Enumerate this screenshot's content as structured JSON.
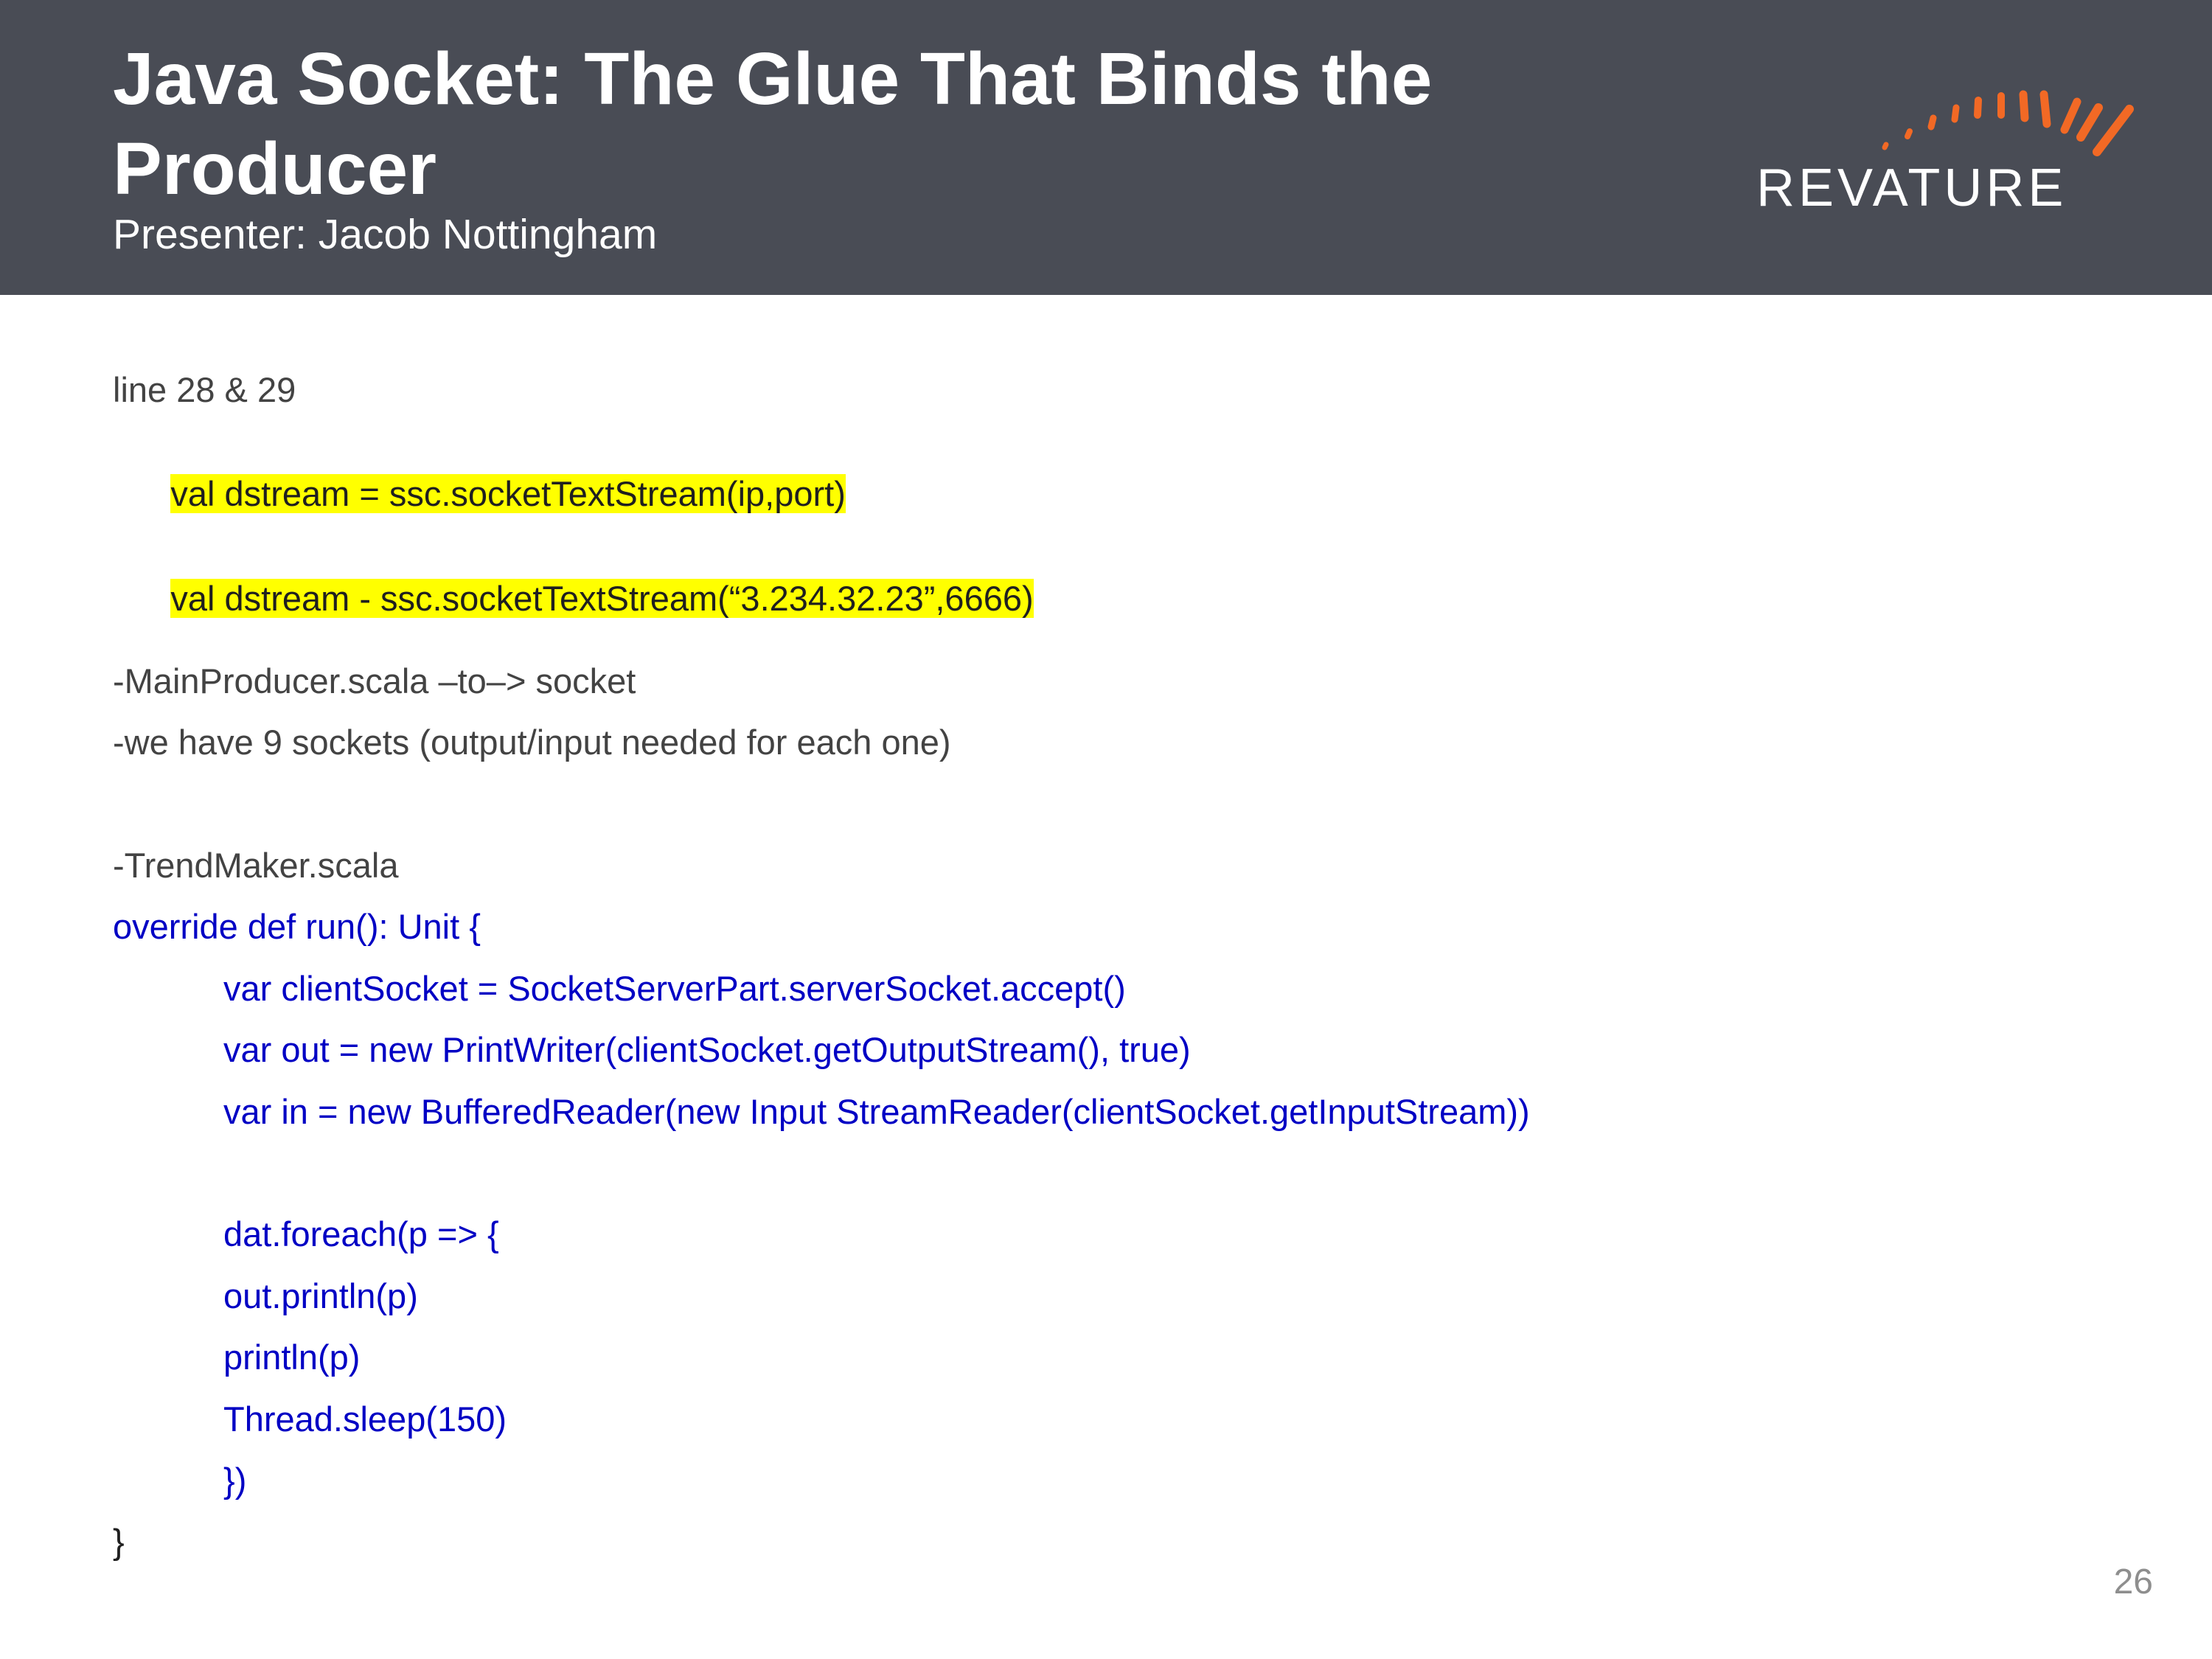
{
  "header": {
    "title": "Java Socket: The Glue That Binds the Producer",
    "subtitle": "Presenter: Jacob Nottingham",
    "background_color": "#494c55"
  },
  "logo": {
    "text": "REVATURE",
    "accent_color": "#f26925",
    "icon": "sunburst-arc-icon"
  },
  "body": {
    "line_ref": "line 28 & 29",
    "highlight_1": "val dstream = ssc.socketTextStream(ip,port)",
    "highlight_2": "val dstream - ssc.socketTextStream(“3.234.32.23”,6666)",
    "note_1": "-MainProducer.scala –to–> socket",
    "note_2": "-we have 9 sockets (output/input needed for each one)",
    "file_ref": "-TrendMaker.scala",
    "code": [
      "override def run(): Unit {",
      "var clientSocket = SocketServerPart.serverSocket.accept()",
      "var out = new PrintWriter(clientSocket.getOutputStream(), true)",
      "var in = new BufferedReader(new Input StreamReader(clientSocket.getInputStream))",
      "dat.foreach(p => {",
      "out.println(p)",
      "println(p)",
      "Thread.sleep(150)",
      "})",
      "}"
    ],
    "highlight_color": "#ffff00",
    "code_color": "#0000c4"
  },
  "footer": {
    "page_number": "26"
  }
}
